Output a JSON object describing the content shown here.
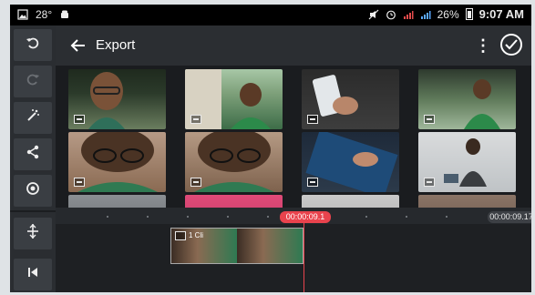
{
  "status_bar": {
    "left_icons": [
      "image-icon",
      "temperature-icon",
      "android-icon"
    ],
    "left_text": "28°",
    "right_icons": [
      "no-sound-icon",
      "alarm-icon",
      "signal-icon",
      "signal-bars-icon",
      "battery-icon"
    ],
    "battery": "26%",
    "time": "9:07 AM"
  },
  "header": {
    "title": "Export"
  },
  "sidebar": {
    "items": [
      "undo-icon",
      "redo-icon",
      "effects-icon",
      "share-icon",
      "settings-icon",
      "split-icon",
      "rewind-icon"
    ]
  },
  "timeline": {
    "current_time": "00:00:09.1",
    "total_time": "00:00:09.17",
    "clip_label": "1 Cli"
  },
  "media": {
    "rows": 3,
    "columns": 4
  }
}
